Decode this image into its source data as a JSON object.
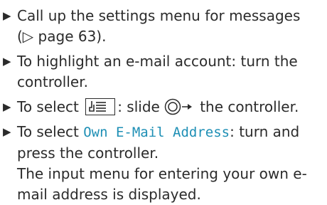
{
  "steps": [
    {
      "line1": "Call up the settings menu for messages",
      "line2": "(▷ page 63)."
    },
    {
      "line1": "To highlight an e-mail account: turn the",
      "line2": "controller."
    },
    {
      "prefix": "To select",
      "middle": ": slide",
      "suffix": "the controller.",
      "key_icon": "menu-settings-icon",
      "controller_icon": "controller-slide-right-icon"
    },
    {
      "prefix": "To select",
      "menu_item": "Own E-Mail Address",
      "suffix": ": turn and",
      "line2": "press the controller.",
      "result_line1": "The input menu for entering your own e-",
      "result_line2": "mail address is displayed."
    }
  ],
  "colors": {
    "text": "#2b2b2b",
    "menu_item": "#1e8fb5"
  }
}
